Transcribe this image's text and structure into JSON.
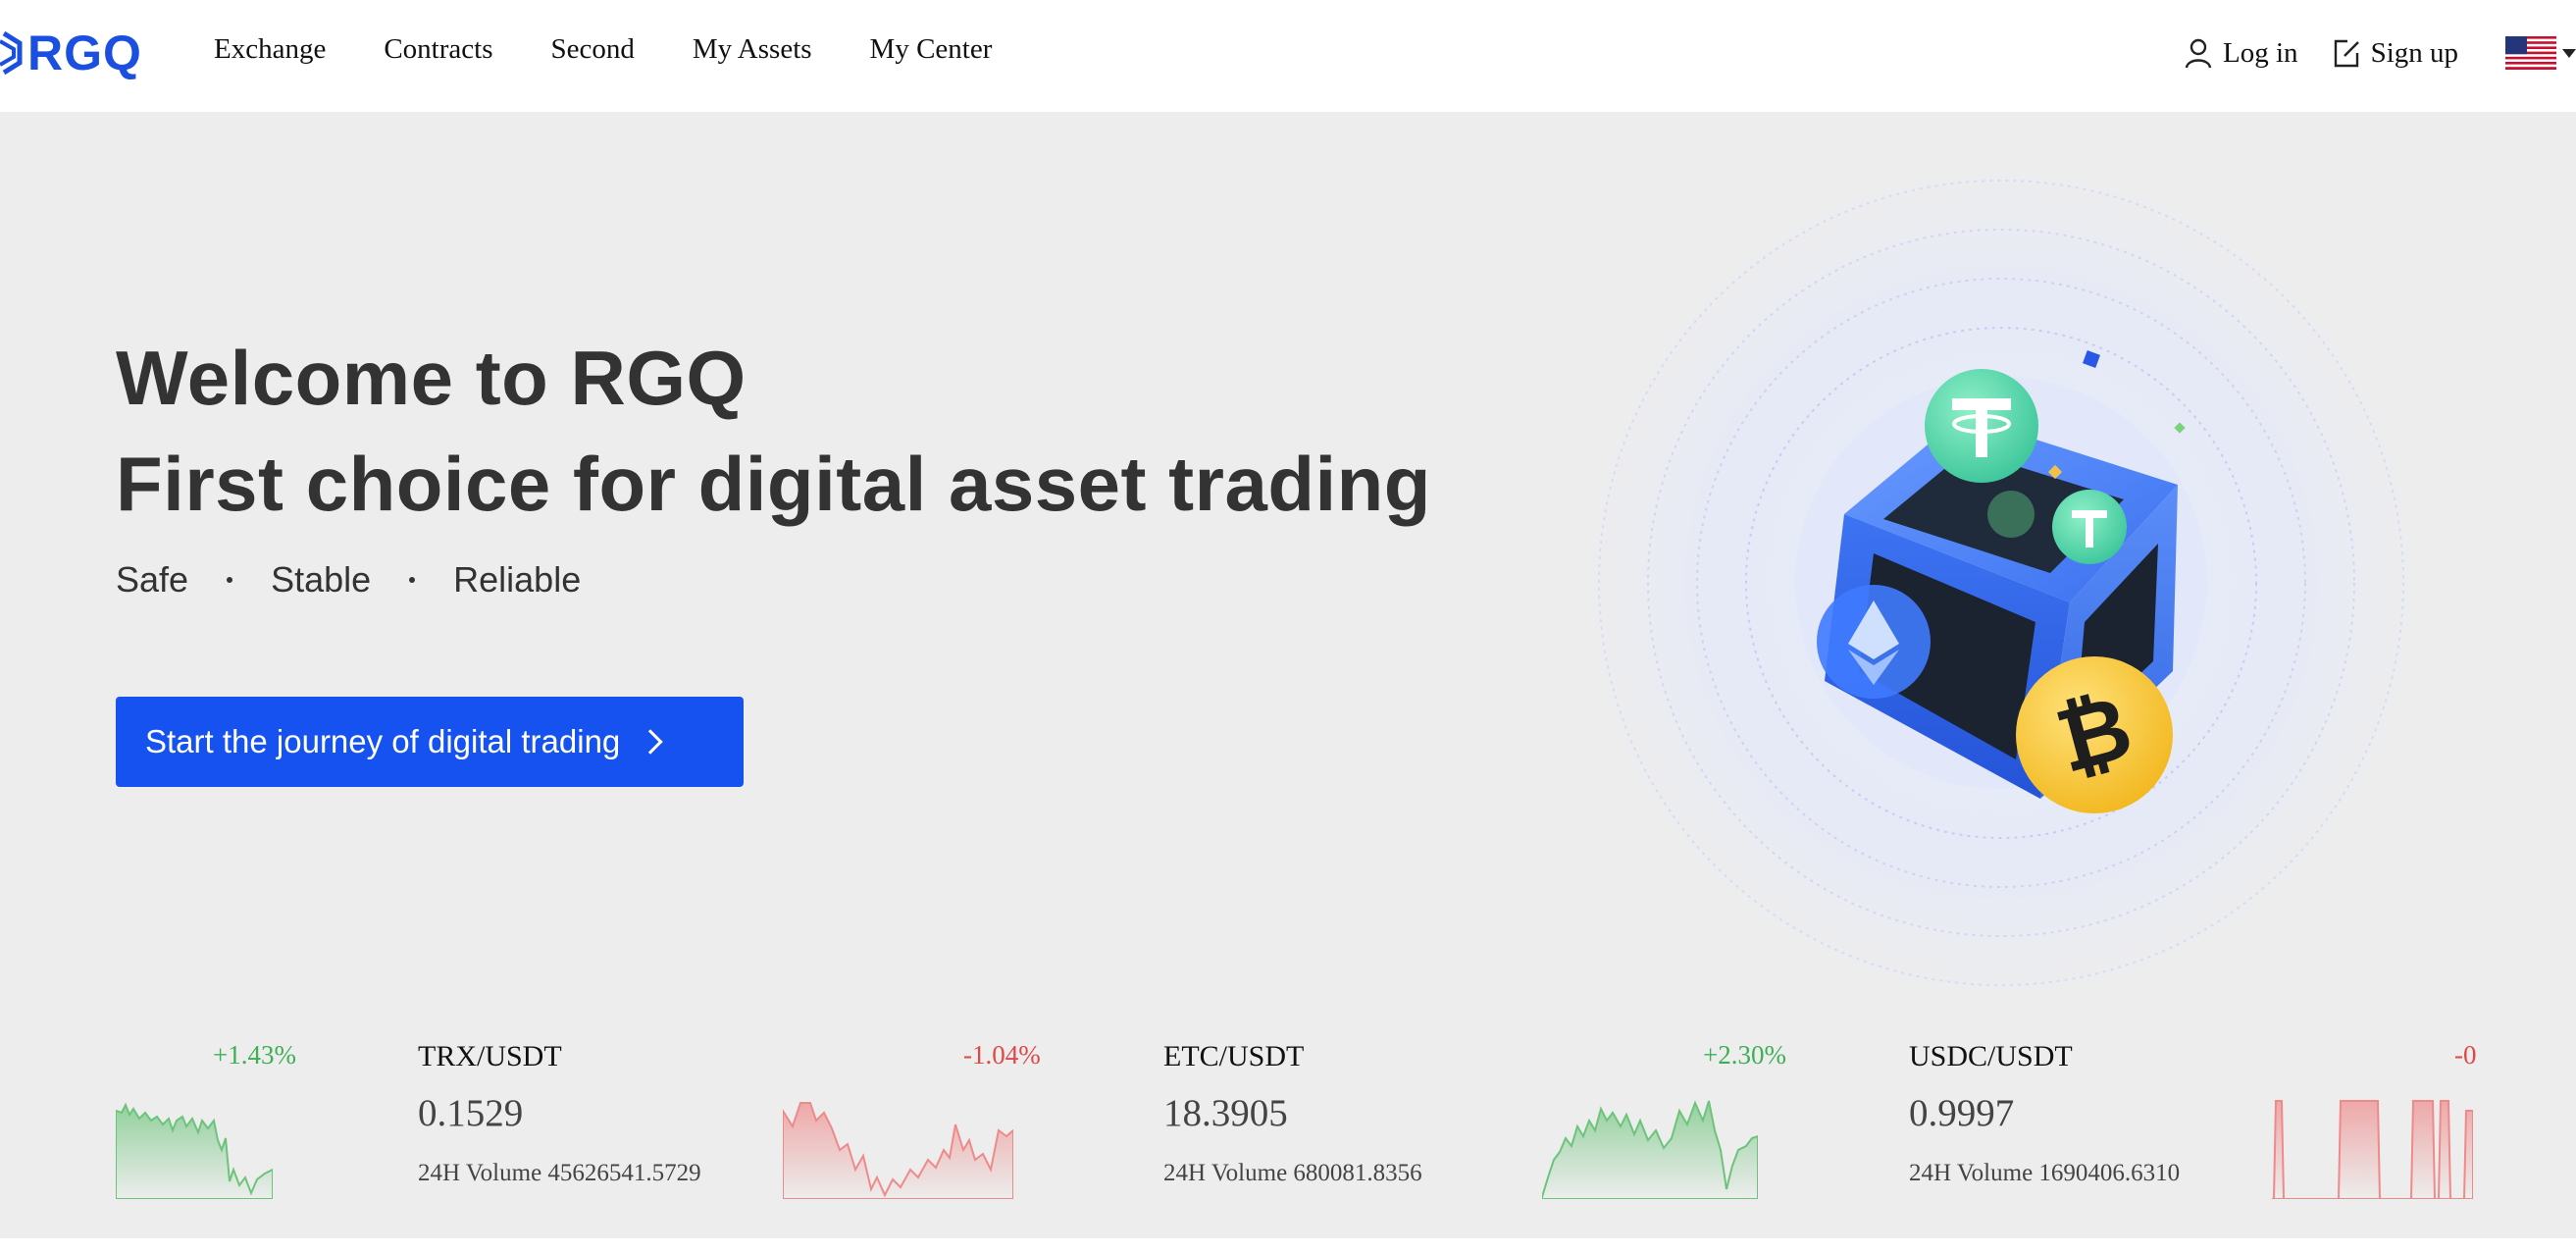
{
  "brand": {
    "logo_text": "RGQ"
  },
  "nav": {
    "items": [
      {
        "label": "Exchange"
      },
      {
        "label": "Contracts"
      },
      {
        "label": "Second"
      },
      {
        "label": "My Assets"
      },
      {
        "label": "My Center"
      }
    ]
  },
  "auth": {
    "login_label": "Log in",
    "signup_label": "Sign up",
    "language_icon": "us-flag-icon"
  },
  "hero": {
    "title_line1": "Welcome to RGQ",
    "title_line2": "First choice for digital asset trading",
    "taglines": [
      "Safe",
      "Stable",
      "Reliable"
    ],
    "cta_label": "Start the journey of digital trading"
  },
  "colors": {
    "accent": "#1652f0",
    "up": "#3fae55",
    "down": "#e04848",
    "hero_bg": "#ededed"
  },
  "tickers": [
    {
      "pair": "",
      "price": "",
      "volume": "",
      "change": "+1.43%",
      "trend": "up"
    },
    {
      "pair": "TRX/USDT",
      "price": "0.1529",
      "volume": "24H Volume 45626541.5729",
      "change": "-1.04%",
      "trend": "down"
    },
    {
      "pair": "ETC/USDT",
      "price": "18.3905",
      "volume": "24H Volume 680081.8356",
      "change": "+2.30%",
      "trend": "up"
    },
    {
      "pair": "USDC/USDT",
      "price": "0.9997",
      "volume": "24H Volume 1690406.6310",
      "change": "-0",
      "trend": "down"
    }
  ]
}
